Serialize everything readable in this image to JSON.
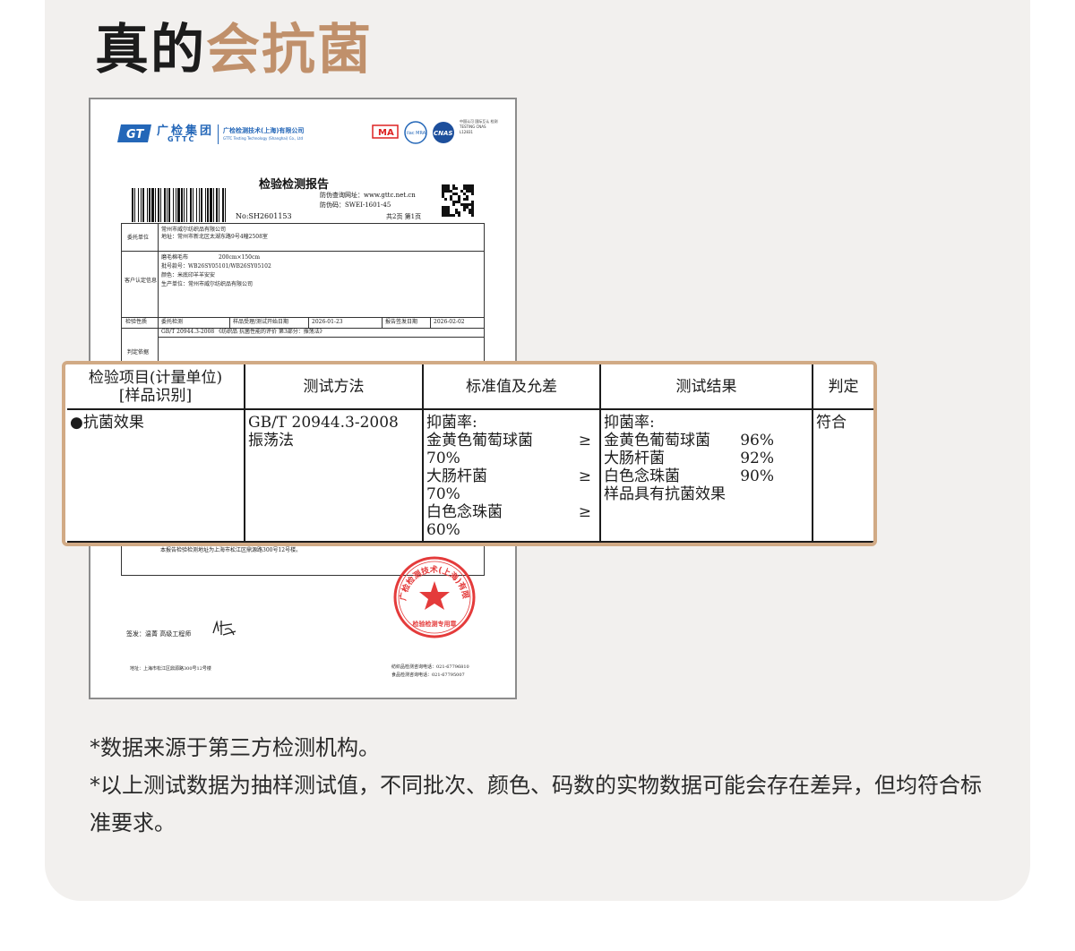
{
  "page": {
    "title_dark": "真的",
    "title_accent": "会抗菌",
    "accent_color": "#c0906b",
    "card_color": "#f2f0ee"
  },
  "report": {
    "org_name": "广检集团",
    "org_abbr": "GTTC",
    "org_full": "广检检测技术(上海)有限公司",
    "org_full_en": "GTTC Testing Technology (Shanghai) Co., Ltd",
    "cert_ma": "MA",
    "cert_ilac": "ilac MRA",
    "cert_cnas": "CNAS",
    "cert_text": "中国认可 国际互认 检测 TESTING CNAS L12831",
    "title": "检验检测报告",
    "verify_site": "防伪查询网址：www.gttc.net.cn",
    "verify_code": "防伪码：SWEI-1601-45",
    "doc_no": "No:SH2601153",
    "pages": "共2页 第1页",
    "client_label": "委托单位",
    "client_name": "常州市威尔纺织品有限公司",
    "client_addr": "地址：常州市新北区太湖东路9号4幢2508室",
    "sample_label": "客户认定信息",
    "sample_name": "磨毛棉毛布",
    "sample_size": "200cm×150cm",
    "sample_batch": "批号款号：WB26SY05101/WB26SY05102",
    "sample_color": "颜色：米底印羊羊安安",
    "sample_maker": "生产单位：常州市威尔纺织品有限公司",
    "nature_label": "检验性质",
    "nature_value": "委托检测",
    "received_label": "样品受理/测试开始日期",
    "received_date": "2026-01-23",
    "issued_label": "报告签发日期",
    "issued_date": "2026-02-02",
    "standard_line": "GB/T 20944.3-2008 《纺织品 抗菌性能的评价 第3部分：振荡法》",
    "basis_label": "判定依据",
    "footnote": "本报告检验检测地址为上海市松江区鼎源路300号12号楼。",
    "seal_text": "广检检测技术(上海)有限公司",
    "seal_sub": "检验检测专用章",
    "sign_label": "签发：温菁  高级工程师",
    "addr_left": "地址：上海市松江区鼎源路300号12号楼",
    "phone1": "纺织品检测咨询电话：021-67796810",
    "phone2": "食品检测咨询电话：021-67795007"
  },
  "table": {
    "headers": [
      "检验项目(计量单位)",
      "[样品识别]",
      "测试方法",
      "标准值及允差",
      "测试结果",
      "判定"
    ],
    "item": "●抗菌效果",
    "method_line1": "GB/T 20944.3-2008",
    "method_line2": "振荡法",
    "std_title": "抑菌率:",
    "std_rows": [
      {
        "name": "金黄色葡萄球菌",
        "op": "≥",
        "value": "70%"
      },
      {
        "name": "大肠杆菌",
        "op": "≥",
        "value": "70%"
      },
      {
        "name": "白色念珠菌",
        "op": "≥",
        "value": "60%"
      }
    ],
    "result_title": "抑菌率:",
    "result_rows": [
      {
        "name": "金黄色葡萄球菌",
        "value": "96%"
      },
      {
        "name": "大肠杆菌",
        "value": "92%"
      },
      {
        "name": "白色念珠菌",
        "value": "90%"
      }
    ],
    "result_conclusion": "样品具有抗菌效果",
    "verdict": "符合"
  },
  "notes": [
    "*数据来源于第三方检测机构。",
    "*以上测试数据为抽样测试值，不同批次、颜色、码数的实物数据可能会存在差异，但均符合标准要求。"
  ]
}
